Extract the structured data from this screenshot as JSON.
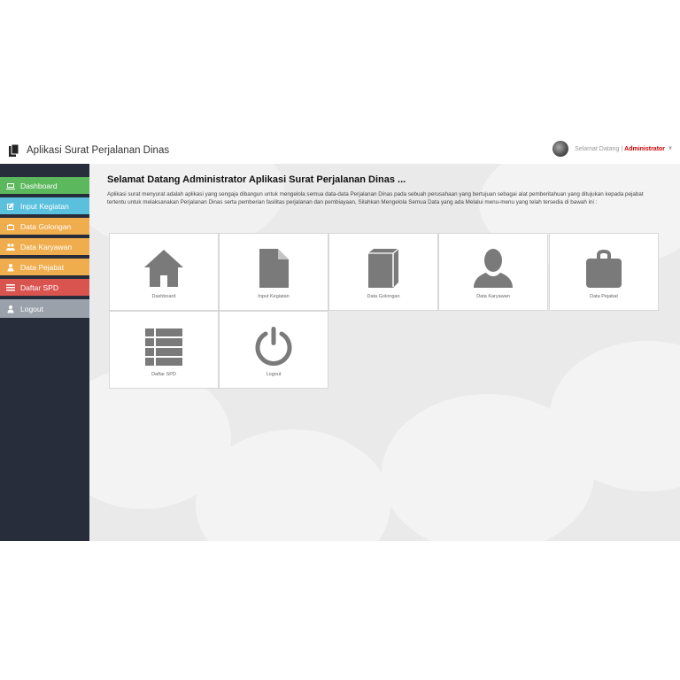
{
  "header": {
    "title": "Aplikasi Surat Perjalanan Dinas",
    "greeting": "Selamat Datang |",
    "user_role": "Administrator"
  },
  "sidebar": {
    "items": [
      {
        "label": "Dashboard",
        "color": "#5cb85c",
        "icon": "laptop-icon"
      },
      {
        "label": "Input Kegiatan",
        "color": "#5bc0de",
        "icon": "edit-icon"
      },
      {
        "label": "Data Golongan",
        "color": "#f0ad4e",
        "icon": "briefcase-icon"
      },
      {
        "label": "Data Karyawan",
        "color": "#f0ad4e",
        "icon": "users-icon"
      },
      {
        "label": "Data Pejabat",
        "color": "#f0ad4e",
        "icon": "user-icon"
      },
      {
        "label": "Daftar SPD",
        "color": "#d9534f",
        "icon": "list-icon"
      },
      {
        "label": "Logout",
        "color": "#9aa1ab",
        "icon": "user-icon"
      }
    ]
  },
  "main": {
    "heading": "Selamat Datang Administrator Aplikasi Surat Perjalanan Dinas ...",
    "description": "Aplikasi surat menyurat adalah aplikasi yang sengaja dibangun untuk mengelola semua data-data Perjalanan Dinas pada sebuah perusahaan yang bertujuan sebagai alat pemberitahuan yang ditujukan kepada pejabat tertentu untuk melaksanakan Perjalanan Dinas serta pemberian fasilitas perjalanan dan pembiayaan, Silahkan Mengelola Semua Data yang ada Melalui menu-menu yang telah tersedia di bawah ini :",
    "tiles": [
      {
        "label": "Dashboard",
        "icon": "home-icon"
      },
      {
        "label": "Input Kegiatan",
        "icon": "file-icon"
      },
      {
        "label": "Data Golongan",
        "icon": "book-icon"
      },
      {
        "label": "Data Karyawan",
        "icon": "user-icon"
      },
      {
        "label": "Data Pejabat",
        "icon": "briefcase-icon"
      },
      {
        "label": "Daftar SPD",
        "icon": "list-icon"
      },
      {
        "label": "Logout",
        "icon": "power-icon"
      }
    ]
  },
  "colors": {
    "sidebar_bg": "#272d3b",
    "accent_red": "#cc0000",
    "icon_gray": "#7a7a7a"
  }
}
